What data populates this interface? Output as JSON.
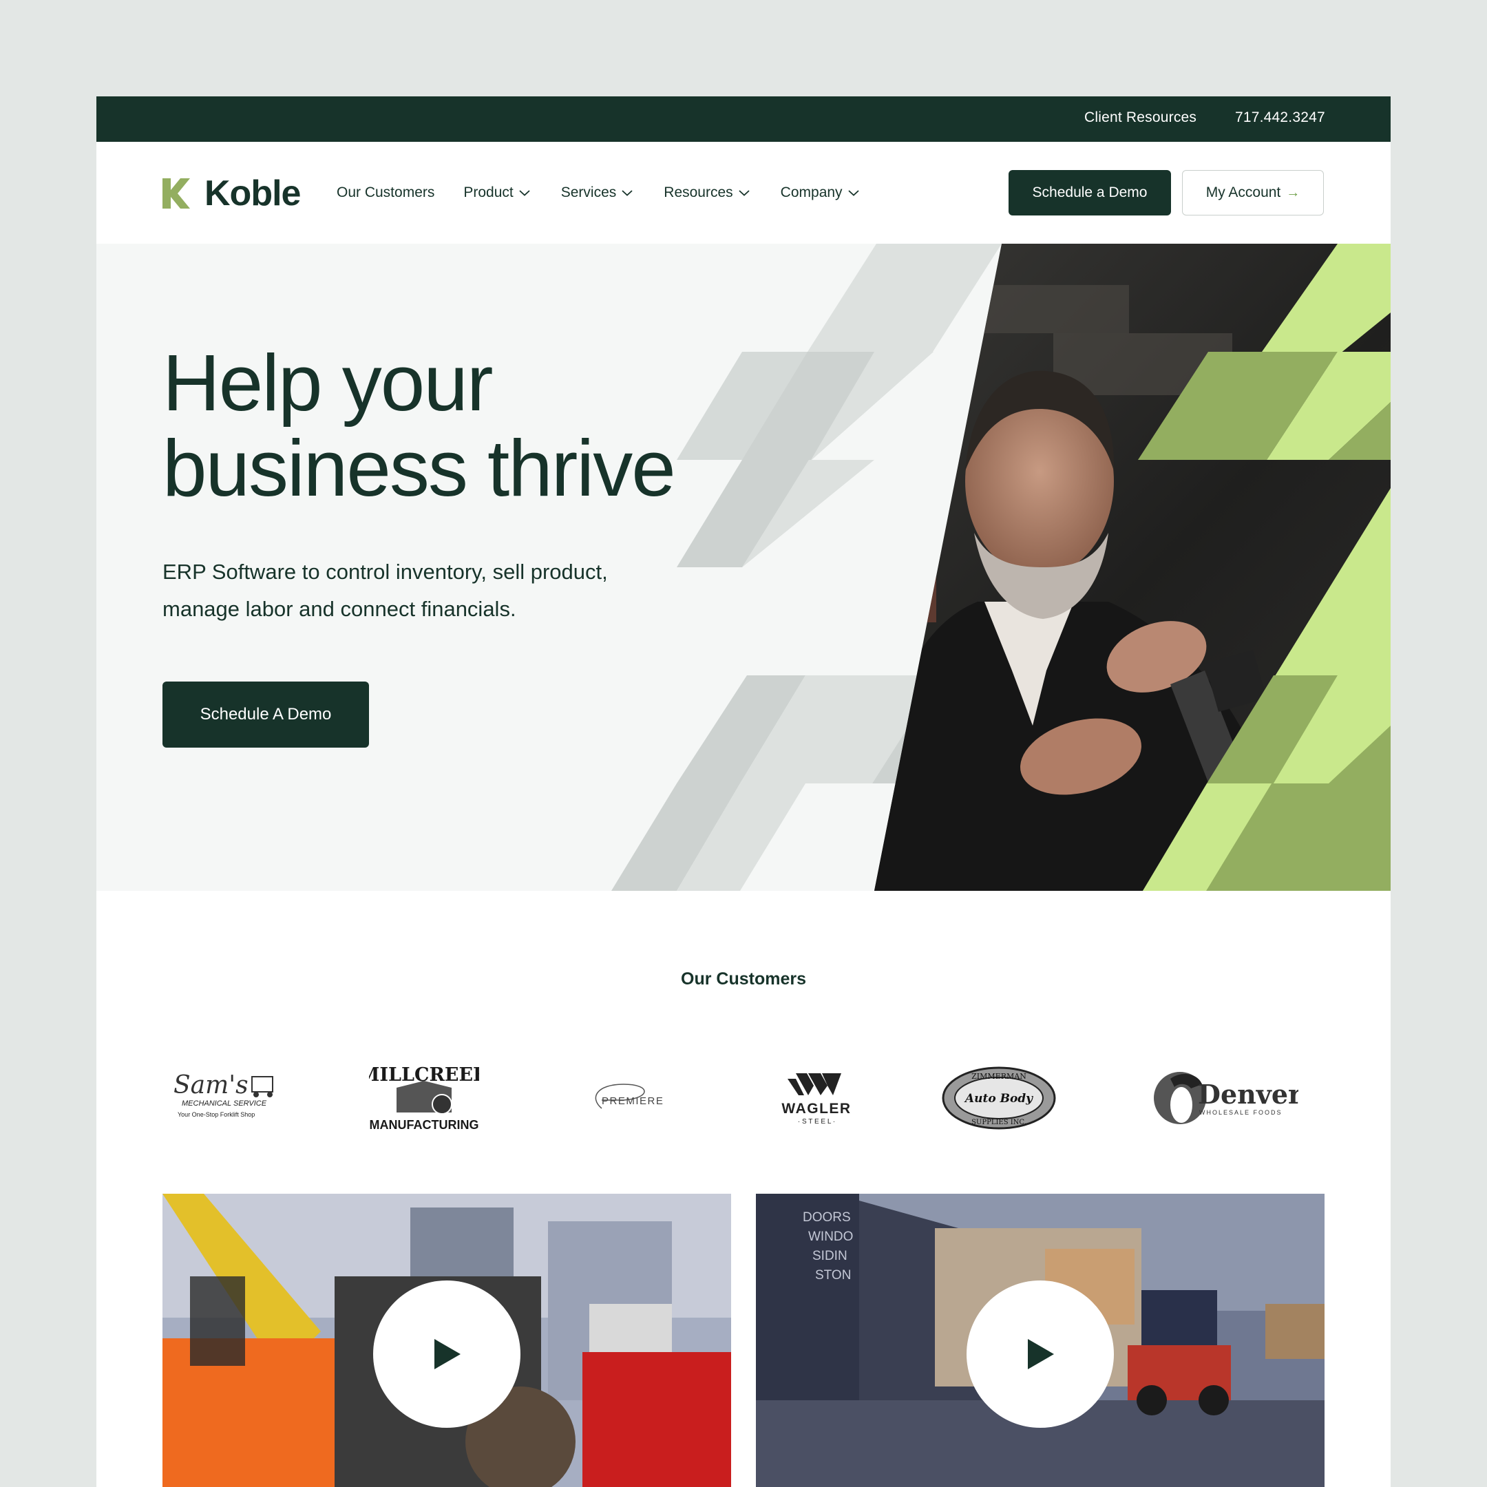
{
  "utility_bar": {
    "client_resources": "Client Resources",
    "phone": "717.442.3247"
  },
  "brand": {
    "name": "Koble",
    "colors": {
      "dark_green": "#17332a",
      "lime": "#c9e88c",
      "olive": "#93ae60",
      "light_gray": "#f5f7f6",
      "mid_gray": "#d7dcd9"
    }
  },
  "nav": {
    "items": [
      {
        "label": "Our Customers",
        "dropdown": false
      },
      {
        "label": "Product",
        "dropdown": true
      },
      {
        "label": "Services",
        "dropdown": true
      },
      {
        "label": "Resources",
        "dropdown": true
      },
      {
        "label": "Company",
        "dropdown": true
      }
    ],
    "schedule_demo": "Schedule a Demo",
    "my_account": "My Account",
    "my_account_icon": "arrow-right-icon"
  },
  "hero": {
    "title_line1": "Help your",
    "title_line2": "business thrive",
    "subtitle": "ERP Software to control inventory, sell product, manage labor and connect financials.",
    "cta": "Schedule A Demo",
    "image": "photo of bearded mechanic working on machinery"
  },
  "customers": {
    "heading": "Our Customers",
    "logos": [
      {
        "name": "sams-mechanical-logo",
        "line1": "Sam's",
        "line2": "MECHANICAL SERVICE",
        "line3": "Your One-Stop Forklift Shop"
      },
      {
        "name": "millcreek-logo",
        "line1": "MILLCREEK",
        "line2": "MANUFACTURING"
      },
      {
        "name": "premiere-logo",
        "line1": "PREMIERE"
      },
      {
        "name": "wagler-steel-logo",
        "line1": "WAGLER",
        "line2": "· S T E E L ·"
      },
      {
        "name": "zimmerman-logo",
        "line1": "ZIMMERMAN",
        "line2": "Auto Body",
        "line3": "SUPPLIES INC."
      },
      {
        "name": "denver-logo",
        "line1": "Denver",
        "line2": "WHOLESALE FOODS"
      }
    ]
  },
  "videos": [
    {
      "name": "video-forklift-repair",
      "icon": "play-icon"
    },
    {
      "name": "video-lumber-yard",
      "icon": "play-icon",
      "sign_lines": [
        "DOORS",
        "WINDO",
        "SIDIN",
        "STON"
      ]
    }
  ]
}
